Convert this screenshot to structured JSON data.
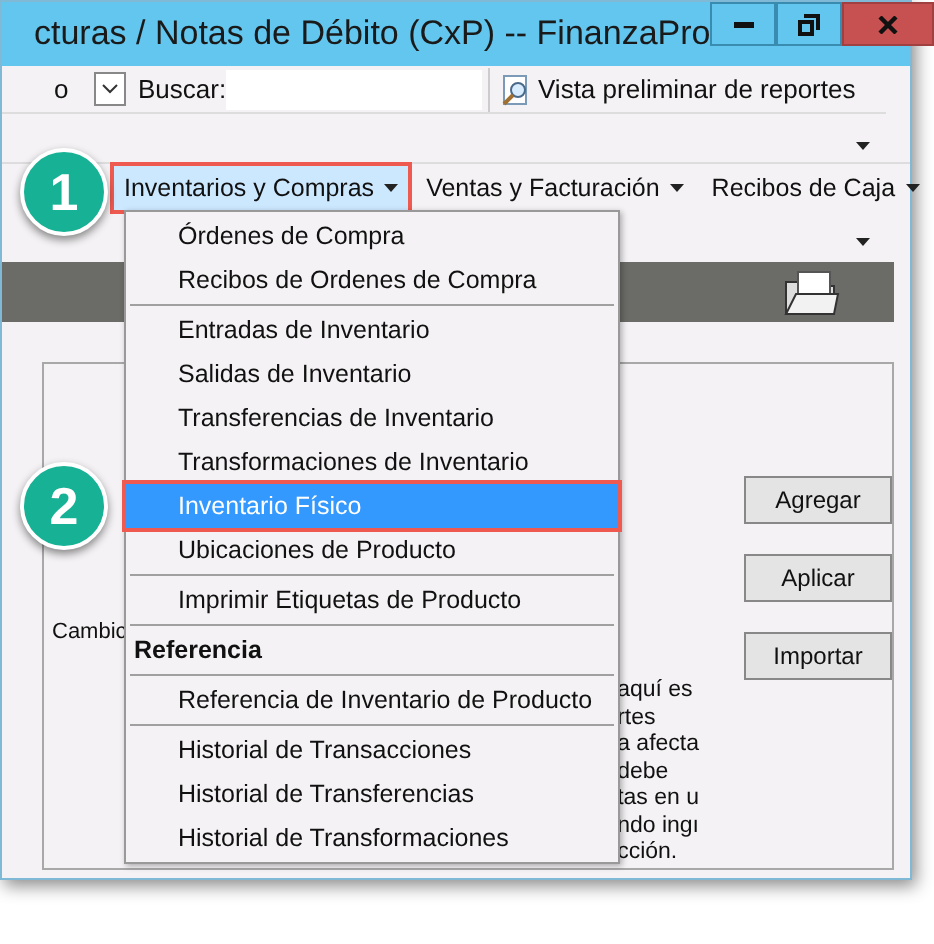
{
  "window": {
    "title": "cturas / Notas de Débito (CxP) -- FinanzaPro"
  },
  "toolbar": {
    "cut_text": "o",
    "search_label": "Buscar:",
    "report_button": "Vista preliminar de reportes"
  },
  "menubar": [
    {
      "label": "Inventarios y Compras",
      "selected": true,
      "highlighted": true
    },
    {
      "label": "Ventas y Facturación",
      "selected": false,
      "highlighted": false
    },
    {
      "label": "Recibos de Caja",
      "selected": false,
      "highlighted": false
    }
  ],
  "menu": [
    {
      "kind": "item",
      "label": "Órdenes de Compra",
      "selected": false,
      "highlighted": false
    },
    {
      "kind": "item",
      "label": "Recibos de Ordenes de Compra",
      "selected": false,
      "highlighted": false
    },
    {
      "kind": "separator"
    },
    {
      "kind": "item",
      "label": "Entradas de Inventario",
      "selected": false,
      "highlighted": false
    },
    {
      "kind": "item",
      "label": "Salidas de Inventario",
      "selected": false,
      "highlighted": false
    },
    {
      "kind": "item",
      "label": "Transferencias de Inventario",
      "selected": false,
      "highlighted": false
    },
    {
      "kind": "item",
      "label": "Transformaciones de Inventario",
      "selected": false,
      "highlighted": false
    },
    {
      "kind": "item",
      "label": "Inventario Físico",
      "selected": true,
      "highlighted": true
    },
    {
      "kind": "item",
      "label": "Ubicaciones de Producto",
      "selected": false,
      "highlighted": false
    },
    {
      "kind": "separator"
    },
    {
      "kind": "item",
      "label": "Imprimir Etiquetas de Producto",
      "selected": false,
      "highlighted": false
    },
    {
      "kind": "separator"
    },
    {
      "kind": "header",
      "label": "Referencia"
    },
    {
      "kind": "separator"
    },
    {
      "kind": "item",
      "label": "Referencia de Inventario de Producto",
      "selected": false,
      "highlighted": false
    },
    {
      "kind": "separator"
    },
    {
      "kind": "item",
      "label": "Historial de Transacciones",
      "selected": false,
      "highlighted": false
    },
    {
      "kind": "item",
      "label": "Historial de Transferencias",
      "selected": false,
      "highlighted": false
    },
    {
      "kind": "item",
      "label": "Historial de Transformaciones",
      "selected": false,
      "highlighted": false
    }
  ],
  "callouts": [
    "1",
    "2"
  ],
  "panel": {
    "left_text": "Cambic",
    "right_text": [
      "aquí es",
      "rtes",
      "a afecta",
      "debe",
      "tas en u",
      "ndo ingı",
      "cción."
    ],
    "buttons": [
      "Agregar",
      "Aplicar",
      "Importar"
    ]
  }
}
